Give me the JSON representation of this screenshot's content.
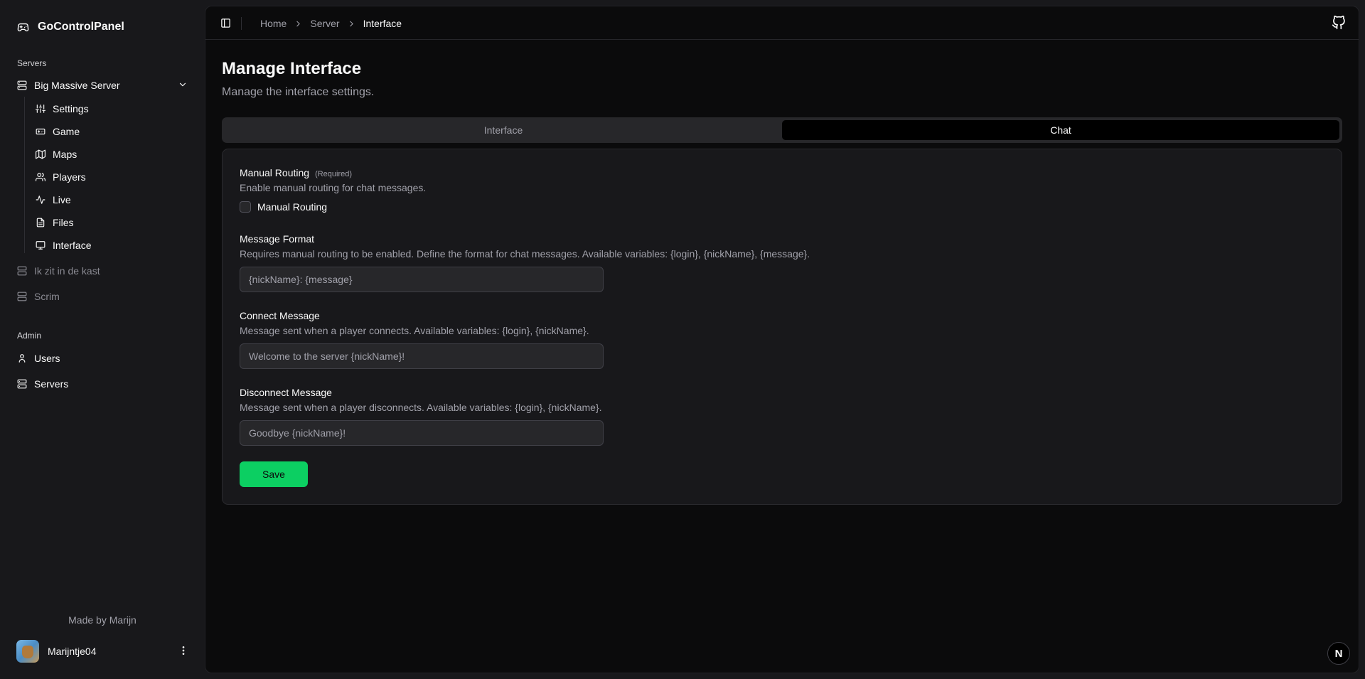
{
  "app": {
    "name": "GoControlPanel"
  },
  "sidebar": {
    "servers_label": "Servers",
    "active_server": "Big Massive Server",
    "sub_items": [
      {
        "label": "Settings",
        "icon": "sliders-icon"
      },
      {
        "label": "Game",
        "icon": "gamepad-icon"
      },
      {
        "label": "Maps",
        "icon": "map-icon"
      },
      {
        "label": "Players",
        "icon": "users-icon"
      },
      {
        "label": "Live",
        "icon": "activity-icon"
      },
      {
        "label": "Files",
        "icon": "file-icon"
      },
      {
        "label": "Interface",
        "icon": "monitor-icon"
      }
    ],
    "other_servers": [
      "Ik zit in de kast",
      "Scrim"
    ],
    "admin_label": "Admin",
    "admin_items": [
      {
        "label": "Users",
        "icon": "user-icon"
      },
      {
        "label": "Servers",
        "icon": "server-icon"
      }
    ],
    "footer": {
      "made_by": "Made by Marijn",
      "username": "Marijntje04"
    }
  },
  "breadcrumb": {
    "items": [
      "Home",
      "Server"
    ],
    "current": "Interface"
  },
  "page": {
    "title": "Manage Interface",
    "subtitle": "Manage the interface settings."
  },
  "tabs": [
    {
      "label": "Interface",
      "active": false
    },
    {
      "label": "Chat",
      "active": true
    }
  ],
  "form": {
    "manual_routing": {
      "label": "Manual Routing",
      "required": "(Required)",
      "description": "Enable manual routing for chat messages.",
      "checkbox_label": "Manual Routing",
      "checked": false
    },
    "message_format": {
      "label": "Message Format",
      "description": "Requires manual routing to be enabled. Define the format for chat messages. Available variables: {login}, {nickName}, {message}.",
      "placeholder": "{nickName}: {message}"
    },
    "connect_message": {
      "label": "Connect Message",
      "description": "Message sent when a player connects. Available variables: {login}, {nickName}.",
      "placeholder": "Welcome to the server {nickName}!"
    },
    "disconnect_message": {
      "label": "Disconnect Message",
      "description": "Message sent when a player disconnects. Available variables: {login}, {nickName}.",
      "placeholder": "Goodbye {nickName}!"
    },
    "save_label": "Save"
  },
  "badge": {
    "letter": "N"
  },
  "colors": {
    "accent": "#0ccf62",
    "background": "#18181b",
    "panel": "#0b0b0c"
  }
}
